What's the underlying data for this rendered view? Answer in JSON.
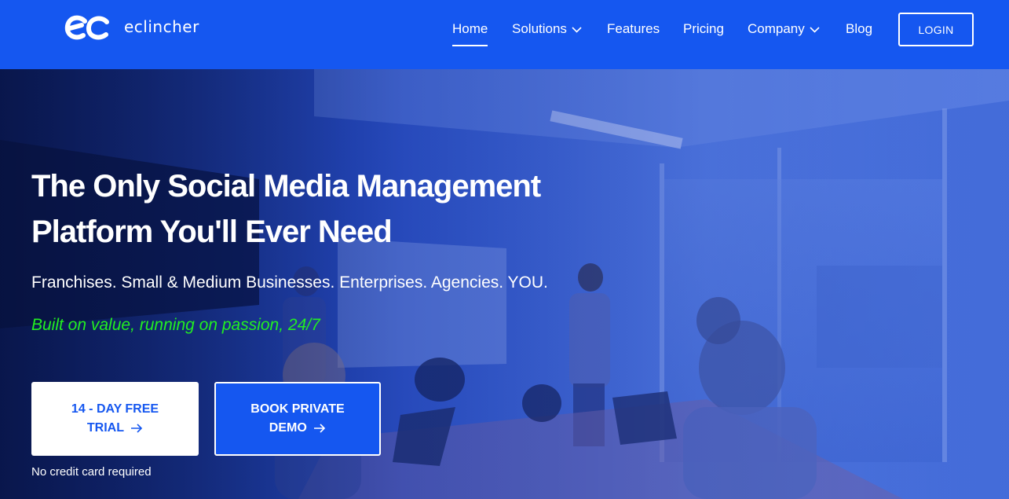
{
  "brand": {
    "name": "eclincher",
    "primary_color": "#1557f0",
    "accent_green": "#22ee22"
  },
  "nav": {
    "items": [
      {
        "label": "Home",
        "active": true,
        "dropdown": false
      },
      {
        "label": "Solutions",
        "active": false,
        "dropdown": true
      },
      {
        "label": "Features",
        "active": false,
        "dropdown": false
      },
      {
        "label": "Pricing",
        "active": false,
        "dropdown": false
      },
      {
        "label": "Company",
        "active": false,
        "dropdown": true
      },
      {
        "label": "Blog",
        "active": false,
        "dropdown": false
      }
    ],
    "login_label": "LOGIN"
  },
  "hero": {
    "headline_line1": "The Only Social Media Management",
    "headline_line2": "Platform You'll Ever Need",
    "subline": "Franchises. Small & Medium Businesses. Enterprises. Agencies. YOU.",
    "tagline": "Built on value, running on passion, 24/7",
    "trial_button": {
      "line1": "14 - DAY FREE",
      "line2": "TRIAL"
    },
    "demo_button": {
      "line1": "BOOK PRIVATE",
      "line2": "DEMO"
    },
    "note": "No credit card required"
  }
}
